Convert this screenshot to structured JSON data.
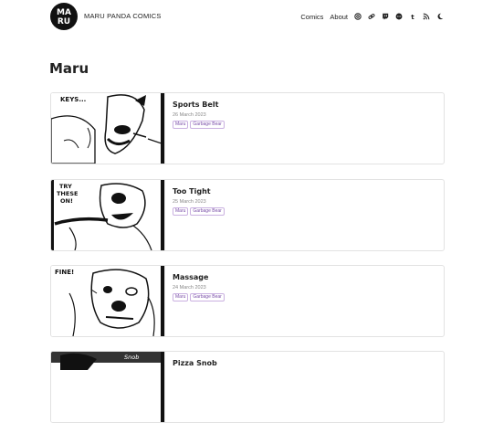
{
  "site": {
    "name": "MARU PANDA COMICS",
    "logo_text": "MARU"
  },
  "nav": {
    "links": [
      "Comics",
      "About"
    ],
    "icons": [
      "email-icon",
      "link-icon",
      "twitch-icon",
      "discord-icon",
      "tumblr-icon",
      "rss-icon",
      "dark-mode-icon"
    ]
  },
  "page": {
    "title": "Maru"
  },
  "posts": [
    {
      "title": "Sports Belt",
      "date": "26 March 2023",
      "tags": [
        "Maru",
        "Garbage Bear"
      ],
      "thumb_caption": "KEYS..."
    },
    {
      "title": "Too Tight",
      "date": "25 March 2023",
      "tags": [
        "Maru",
        "Garbage Bear"
      ],
      "thumb_caption": "TRY THESE ON!"
    },
    {
      "title": "Massage",
      "date": "24 March 2023",
      "tags": [
        "Maru",
        "Garbage Bear"
      ],
      "thumb_caption": "FINE!"
    },
    {
      "title": "Pizza Snob",
      "date": "",
      "tags": [],
      "thumb_caption": "Snob"
    }
  ],
  "colors": {
    "tag_text": "#7a4fa8",
    "tag_border": "#c9b0e0",
    "card_border": "#e2e2e2"
  }
}
